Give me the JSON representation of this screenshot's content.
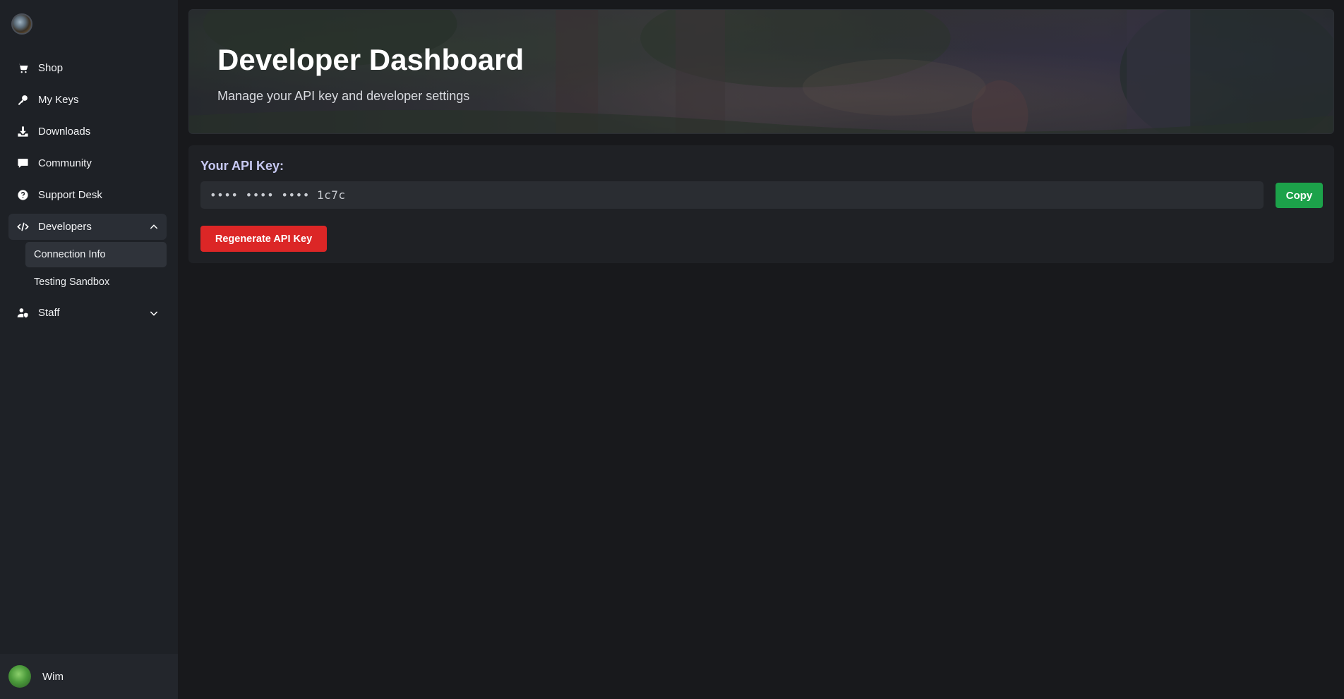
{
  "sidebar": {
    "logo_icon": "game-logo-icon",
    "items": [
      {
        "label": "Shop",
        "icon": "cart-icon"
      },
      {
        "label": "My Keys",
        "icon": "key-icon"
      },
      {
        "label": "Downloads",
        "icon": "download-icon"
      },
      {
        "label": "Community",
        "icon": "chat-icon"
      },
      {
        "label": "Support Desk",
        "icon": "help-icon"
      }
    ],
    "developers": {
      "label": "Developers",
      "icon": "code-icon",
      "expanded": true,
      "children": [
        {
          "label": "Connection Info",
          "active": true
        },
        {
          "label": "Testing Sandbox",
          "active": false
        }
      ]
    },
    "staff": {
      "label": "Staff",
      "icon": "user-shield-icon",
      "expanded": false
    },
    "user": {
      "name": "Wim"
    }
  },
  "hero": {
    "title": "Developer Dashboard",
    "subtitle": "Manage your API key and developer settings"
  },
  "api_card": {
    "label": "Your API Key:",
    "masked_key": "•••• •••• •••• 1c7c",
    "copy_label": "Copy",
    "regenerate_label": "Regenerate API Key"
  },
  "colors": {
    "sidebar_bg": "#1e2126",
    "main_bg": "#18191c",
    "copy_green": "#1ca24a",
    "regenerate_red": "#dc2626",
    "label_lavender": "#c7c9f3"
  }
}
